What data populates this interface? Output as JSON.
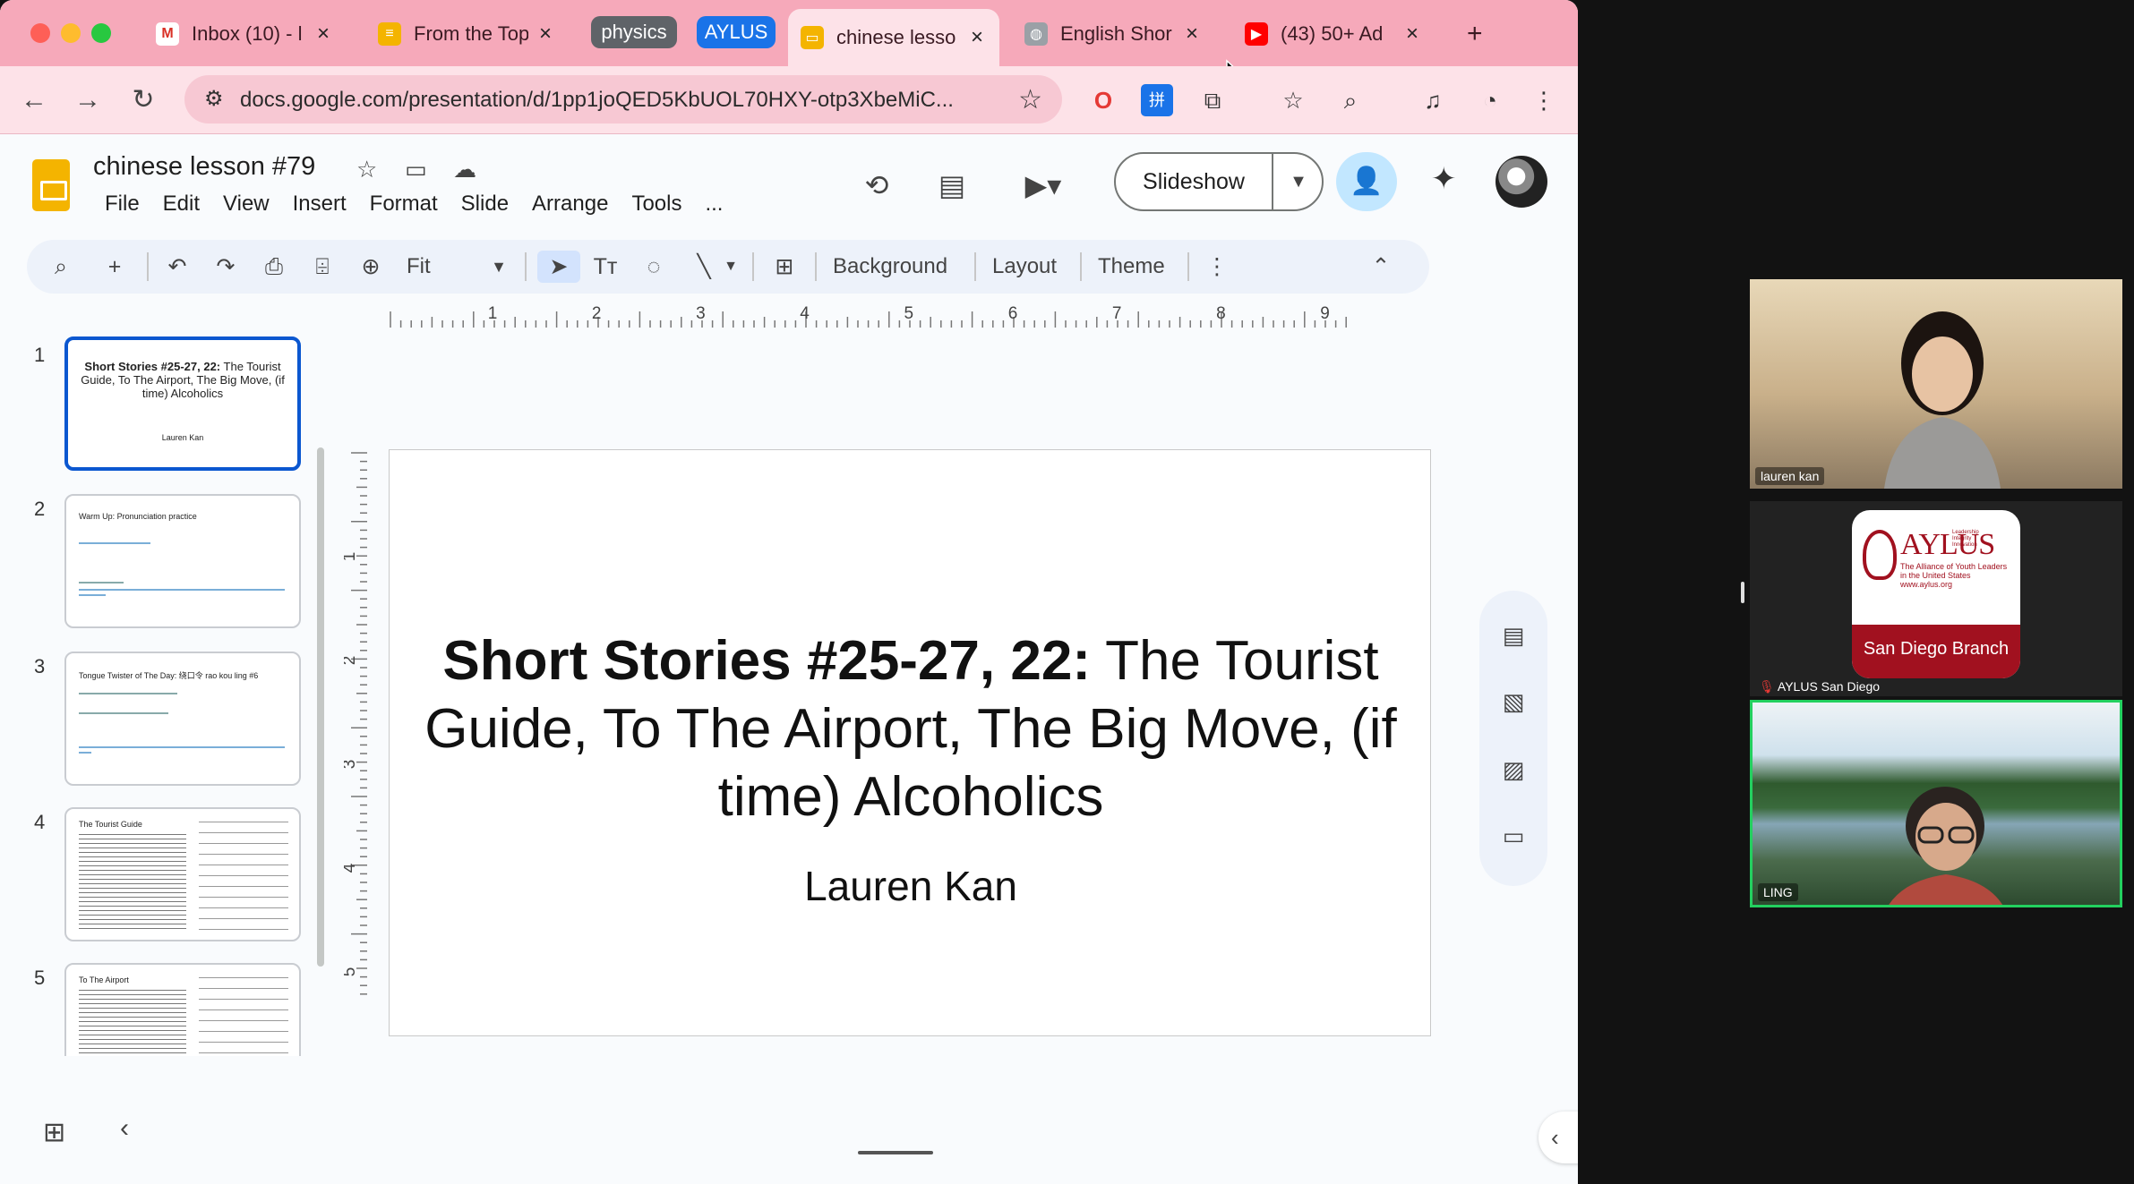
{
  "browser": {
    "tabs": [
      {
        "label": "Inbox (10) - l",
        "icon": "gmail-icon"
      },
      {
        "label": "From the Top",
        "icon": "docs-form-icon"
      },
      {
        "label": "chinese lesso",
        "icon": "slides-icon",
        "active": true
      },
      {
        "label": "English Shor",
        "icon": "globe-icon"
      },
      {
        "label": "(43) 50+ Ad",
        "icon": "youtube-icon"
      }
    ],
    "tab_groups": [
      {
        "label": "physics",
        "color": "#5f6368"
      },
      {
        "label": "AYLUS",
        "color": "#1a73e8"
      }
    ],
    "new_tab": "+",
    "url": "docs.google.com/presentation/d/1pp1joQED5KbUOL70HXY-otp3XbeMiC..."
  },
  "slides": {
    "doc_title": "chinese lesson #79",
    "menus": [
      "File",
      "Edit",
      "View",
      "Insert",
      "Format",
      "Slide",
      "Arrange",
      "Tools",
      "..."
    ],
    "slideshow_label": "Slideshow",
    "toolbar": {
      "zoom": "Fit",
      "background": "Background",
      "layout": "Layout",
      "theme": "Theme"
    },
    "ruler_h": [
      "1",
      "2",
      "3",
      "4",
      "5",
      "6",
      "7",
      "8",
      "9"
    ],
    "ruler_v": [
      "1",
      "2",
      "3",
      "4",
      "5"
    ],
    "thumbnails": [
      {
        "num": "1",
        "title_bold": "Short Stories #25-27, 22:",
        "title_rest": " The Tourist Guide, To The Airport, The Big Move, (if time) Alcoholics",
        "subtitle": "Lauren Kan"
      },
      {
        "num": "2",
        "title": "Warm Up: Pronunciation practice"
      },
      {
        "num": "3",
        "title": "Tongue Twister of The Day: 绕口令 rao kou ling #6"
      },
      {
        "num": "4",
        "title": "The Tourist Guide"
      },
      {
        "num": "5",
        "title": "To The Airport"
      }
    ],
    "current_slide": {
      "title_bold": "Short Stories #25-27, 22:",
      "title_rest": " The Tourist Guide, To The Airport, The Big Move, (if time) Alcoholics",
      "subtitle": "Lauren Kan"
    }
  },
  "zoom": {
    "participants": [
      {
        "name": "lauren kan"
      },
      {
        "name": "AYLUS San Diego"
      },
      {
        "name": "LING"
      }
    ],
    "aylus_logo": {
      "name": "AYLUS",
      "tagline": "Leadership Integrity Innovation",
      "sub1": "The Alliance of Youth Leaders",
      "sub2": "in the United States",
      "web": "www.aylus.org",
      "branch": "San Diego Branch"
    }
  }
}
